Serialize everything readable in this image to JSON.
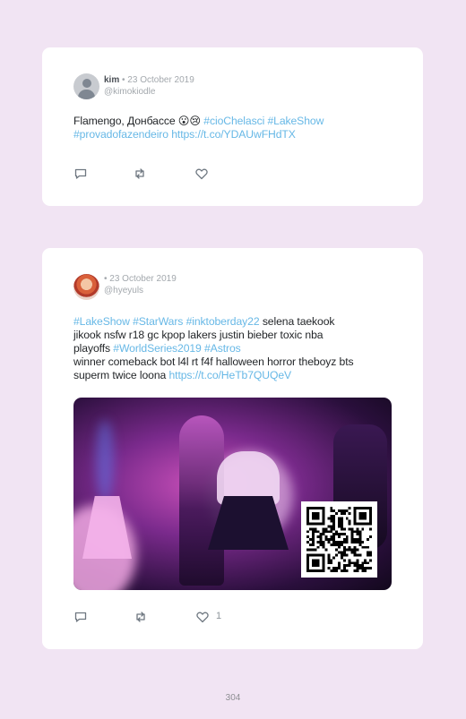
{
  "posts": [
    {
      "name": "kim",
      "date": "• 23 October 2019",
      "handle": "@kimokiodle",
      "line1_plain": "Flamengo, Донбассе 😮😢 ",
      "line1_tags": "#cioChelasci #LakeShow",
      "line2_tags": "#provadofazendeiro ",
      "line2_link": "https://t.co/YDAUwFHdTX"
    },
    {
      "name": "",
      "date": "• 23 October 2019",
      "handle": "@hyeyuls",
      "line1_tags": "#LakeShow #StarWars #inktoberday22",
      "line1_plain": " selena taekook",
      "line2_plain": "jikook nsfw r18 gc kpop lakers justin bieber toxic nba",
      "line3_plain": "playoffs ",
      "line3_tags": "#WorldSeries2019 #Astros",
      "line4_plain": "winner comeback bot l4l rt f4f halloween horror theboyz bts",
      "line5_plain": "superm twice loona ",
      "line5_link": "https://t.co/HeTb7QUQeV",
      "like_count": "1"
    }
  ],
  "icons": [
    "reply-icon",
    "retweet-icon",
    "like-icon"
  ],
  "colors": {
    "background": "#f1e4f3",
    "hashtag": "#67b8e6",
    "card": "#ffffff"
  },
  "page_number": "304"
}
